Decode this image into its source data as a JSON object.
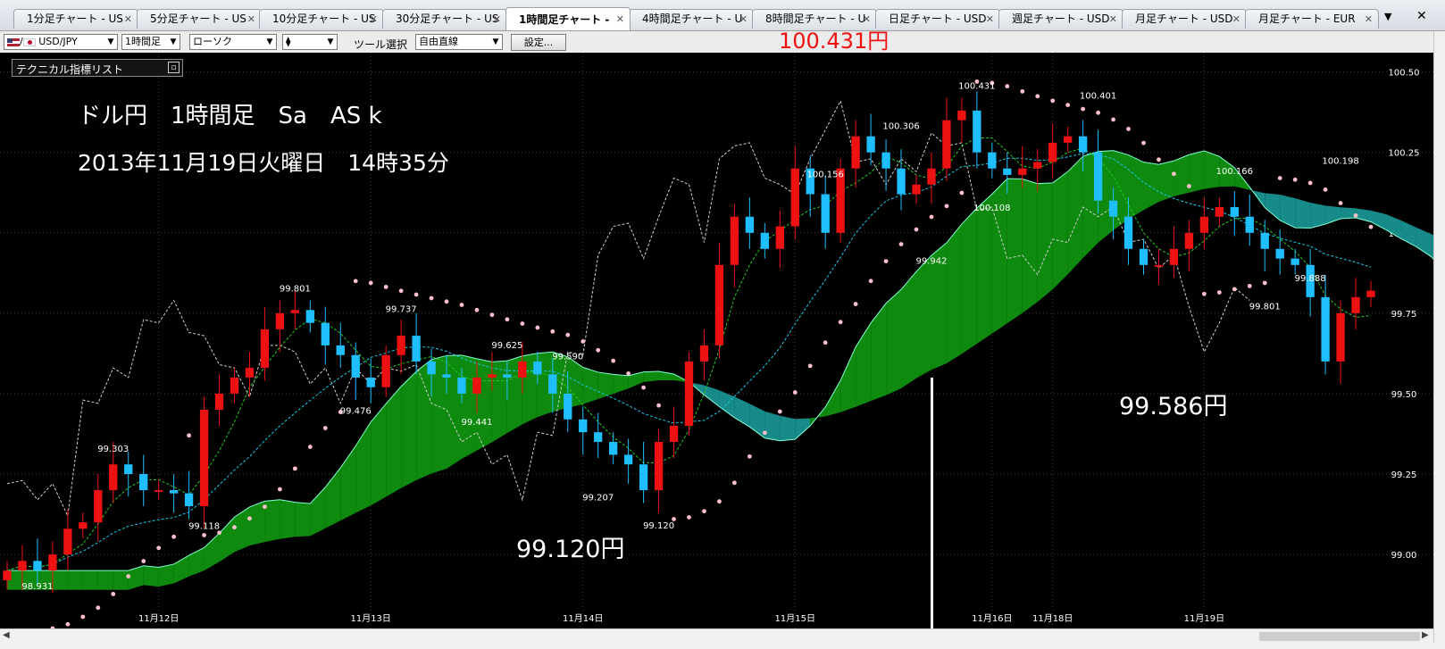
{
  "tabs": [
    {
      "label": "1分足チャート - US"
    },
    {
      "label": "5分足チャート - US"
    },
    {
      "label": "10分足チャート - US"
    },
    {
      "label": "30分足チャート - US"
    },
    {
      "label": "1時間足チャート -",
      "active": true
    },
    {
      "label": "4時間足チャート - U"
    },
    {
      "label": "8時間足チャート - U"
    },
    {
      "label": "日足チャート - USD"
    },
    {
      "label": "週足チャート - USD"
    },
    {
      "label": "月足チャート - USD"
    },
    {
      "label": "月足チャート - EUR"
    }
  ],
  "toolbar": {
    "pair": "USD/JPY",
    "timeframe": "1時間足",
    "chart_type": "ローソク",
    "tool_label": "ツール選択",
    "tool_value": "自由直線",
    "settings_label": "設定..."
  },
  "indicator_panel": "テクニカル指標リスト",
  "annotations": {
    "title": "ドル円　1時間足　Sa　AS k",
    "datetime": "2013年11月19日火曜日　14時35分",
    "high_label": "100.431円",
    "low_label": "99.120円",
    "recent_low_label": "99.586円"
  },
  "colors": {
    "bull": "#ee1111",
    "bear": "#1fbfff",
    "cloud": "#0e8a0e",
    "cloud_bear": "#178a8a",
    "psar": "#ffc0cb",
    "bg": "#000000"
  },
  "chart_data": {
    "type": "candlestick",
    "symbol": "USD/JPY",
    "timeframe": "1時間足",
    "ylim": [
      98.77,
      100.56
    ],
    "y_ticks": [
      {
        "v": 100.5,
        "l": "100.50"
      },
      {
        "v": 100.25,
        "l": "100.25"
      },
      {
        "v": 100.0,
        "l": "100.00"
      },
      {
        "v": 99.75,
        "l": "99.75"
      },
      {
        "v": 99.5,
        "l": "99.50"
      },
      {
        "v": 99.25,
        "l": "99.25"
      },
      {
        "v": 99.0,
        "l": "99.00"
      }
    ],
    "x_labels": [
      {
        "i": 10,
        "l": "11月12日"
      },
      {
        "i": 24,
        "l": "11月13日"
      },
      {
        "i": 38,
        "l": "11月14日"
      },
      {
        "i": 52,
        "l": "11月15日"
      },
      {
        "i": 65,
        "l": "11月16日"
      },
      {
        "i": 69,
        "l": "11月18日"
      },
      {
        "i": 79,
        "l": "11月19日"
      }
    ],
    "closes": [
      98.95,
      98.98,
      98.95,
      99.0,
      99.08,
      99.1,
      99.2,
      99.28,
      99.25,
      99.2,
      99.2,
      99.19,
      99.15,
      99.45,
      99.5,
      99.55,
      99.58,
      99.7,
      99.75,
      99.76,
      99.72,
      99.65,
      99.62,
      99.55,
      99.52,
      99.62,
      99.68,
      99.6,
      99.56,
      99.55,
      99.5,
      99.55,
      99.56,
      99.55,
      99.6,
      99.56,
      99.5,
      99.42,
      99.38,
      99.35,
      99.31,
      99.28,
      99.2,
      99.35,
      99.4,
      99.6,
      99.65,
      99.9,
      100.05,
      100.0,
      99.95,
      100.02,
      100.2,
      100.12,
      100.0,
      100.2,
      100.3,
      100.25,
      100.2,
      100.12,
      100.15,
      100.2,
      100.35,
      100.38,
      100.25,
      100.2,
      100.18,
      100.2,
      100.22,
      100.28,
      100.3,
      100.25,
      100.1,
      100.05,
      99.95,
      99.9,
      99.9,
      99.95,
      100.0,
      100.05,
      100.08,
      100.05,
      100.0,
      99.95,
      99.92,
      99.9,
      99.8,
      99.6,
      99.75,
      99.8,
      99.82
    ],
    "bar_labels": [
      {
        "i": 2,
        "v": 98.931,
        "l": "98.931",
        "pos": "below"
      },
      {
        "i": 7,
        "v": 99.303,
        "l": "99.303",
        "pos": "above"
      },
      {
        "i": 13,
        "v": 99.118,
        "l": "99.118",
        "pos": "below"
      },
      {
        "i": 19,
        "v": 99.801,
        "l": "99.801",
        "pos": "above"
      },
      {
        "i": 23,
        "v": 99.476,
        "l": "99.476",
        "pos": "below"
      },
      {
        "i": 26,
        "v": 99.737,
        "l": "99.737",
        "pos": "above"
      },
      {
        "i": 31,
        "v": 99.441,
        "l": "99.441",
        "pos": "below"
      },
      {
        "i": 33,
        "v": 99.625,
        "l": "99.625",
        "pos": "above"
      },
      {
        "i": 37,
        "v": 99.59,
        "l": "99.590",
        "pos": "above"
      },
      {
        "i": 39,
        "v": 99.207,
        "l": "99.207",
        "pos": "below"
      },
      {
        "i": 43,
        "v": 99.12,
        "l": "99.120",
        "pos": "below"
      },
      {
        "i": 54,
        "v": 100.156,
        "l": "100.156",
        "pos": "above"
      },
      {
        "i": 59,
        "v": 100.306,
        "l": "100.306",
        "pos": "above"
      },
      {
        "i": 61,
        "v": 99.942,
        "l": "99.942",
        "pos": "below"
      },
      {
        "i": 64,
        "v": 100.431,
        "l": "100.431",
        "pos": "above"
      },
      {
        "i": 65,
        "v": 100.108,
        "l": "100.108",
        "pos": "below"
      },
      {
        "i": 72,
        "v": 100.401,
        "l": "100.401",
        "pos": "above"
      },
      {
        "i": 81,
        "v": 100.166,
        "l": "100.166",
        "pos": "above"
      },
      {
        "i": 83,
        "v": 99.801,
        "l": "99.801",
        "pos": "below"
      },
      {
        "i": 86,
        "v": 99.888,
        "l": "99.888",
        "pos": "below"
      },
      {
        "i": 88,
        "v": 100.198,
        "l": "100.198",
        "pos": "above"
      }
    ]
  }
}
